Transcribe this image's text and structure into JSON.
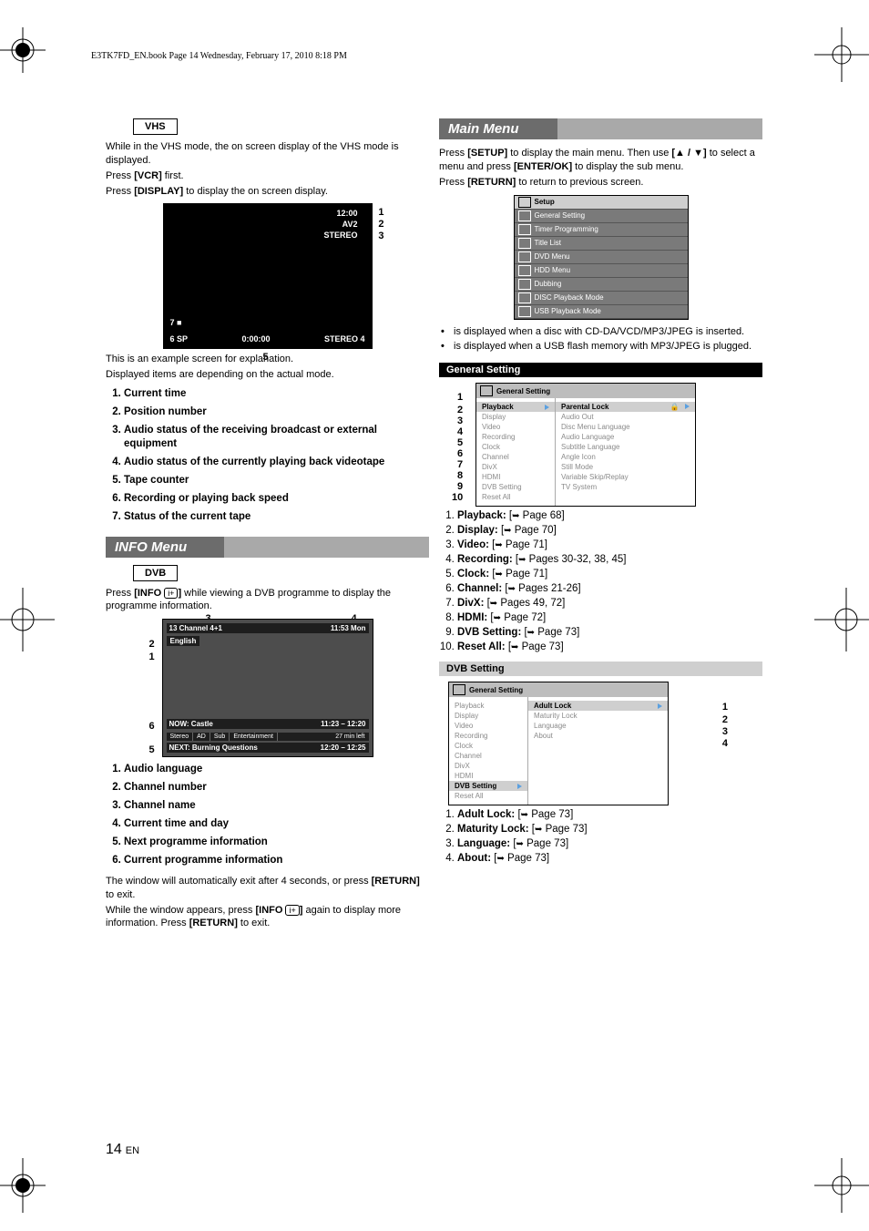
{
  "header_line": "E3TK7FD_EN.book  Page 14  Wednesday, February 17, 2010  8:18 PM",
  "page_num": "14",
  "page_lang": "EN",
  "vhs": {
    "badge": "VHS",
    "p1a": "While in the VHS mode, the on screen display of the VHS mode is displayed.",
    "p2a": "Press ",
    "p2b": "[VCR]",
    "p2c": " first.",
    "p3a": "Press ",
    "p3b": "[DISPLAY]",
    "p3c": " to display the on screen display.",
    "screen": {
      "time": "12:00",
      "av": "AV2",
      "stereo_top": "STEREO",
      "sp": "SP",
      "counter": "0:00:00",
      "stereo_bot": "STEREO",
      "stop": "■"
    },
    "caption1": "This is an example screen for explanation.",
    "caption2": "Displayed items are depending on the actual mode.",
    "defs": [
      "Current time",
      "Position number",
      "Audio status of the receiving broadcast or external equipment",
      "Audio status of the currently playing back videotape",
      "Tape counter",
      "Recording or playing back speed",
      "Status of the current tape"
    ]
  },
  "info": {
    "title": "INFO Menu",
    "badge": "DVB",
    "p1a": "Press ",
    "p1b": "[INFO ",
    "p1c": "]",
    "p1d": " while viewing a DVB programme to display the programme information.",
    "screen": {
      "ch_num": "13",
      "ch_name": "Channel 4+1",
      "time_day": "11:53 Mon",
      "lang": "English",
      "now": "NOW: Castle",
      "now_t": "11:23 – 12:20",
      "tags": [
        "Stereo",
        "AD",
        "Sub",
        "Entertainment"
      ],
      "remain": "27 min left",
      "next": "NEXT: Burning Questions",
      "next_t": "12:20 – 12:25"
    },
    "defs": [
      "Audio language",
      "Channel number",
      "Channel name",
      "Current time and day",
      "Next programme information",
      "Current programme information"
    ],
    "note1a": "The window will automatically exit after 4 seconds, or press ",
    "note1b": "[RETURN]",
    "note1c": " to exit.",
    "note2a": "While the window appears, press ",
    "note2b": "[INFO ",
    "note2c": "]",
    "note2d": " again to display more information. Press ",
    "note2e": "[RETURN]",
    "note2f": " to exit."
  },
  "main": {
    "title": "Main Menu",
    "p1a": "Press ",
    "p1b": "[SETUP]",
    "p1c": " to display the main menu. Then use ",
    "p1d": "[▲ / ▼]",
    "p1e": " to select a menu and press ",
    "p1f": "[ENTER/OK]",
    "p1g": " to display the sub menu.",
    "p2a": "Press ",
    "p2b": "[RETURN]",
    "p2c": " to return to previous screen.",
    "setup_items": [
      "Setup",
      "General Setting",
      "Timer Programming",
      "Title List",
      "DVD Menu",
      "HDD Menu",
      "Dubbing",
      "DISC Playback Mode",
      "USB Playback Mode"
    ],
    "bullets": [
      "is displayed when a disc with CD-DA/VCD/MP3/JPEG is inserted.",
      "is displayed when a USB flash memory with MP3/JPEG is plugged."
    ]
  },
  "general": {
    "bar": "General Setting",
    "left": [
      "Playback",
      "Display",
      "Video",
      "Recording",
      "Clock",
      "Channel",
      "DivX",
      "HDMI",
      "DVB Setting",
      "Reset All"
    ],
    "right": [
      "Parental Lock",
      "Audio Out",
      "Disc Menu Language",
      "Audio Language",
      "Subtitle Language",
      "Angle Icon",
      "Still Mode",
      "Variable Skip/Replay",
      "TV System"
    ],
    "refs": [
      {
        "b": "Playback:",
        "t": " Page 68]"
      },
      {
        "b": "Display:",
        "t": " Page 70]"
      },
      {
        "b": "Video:",
        "t": " Page 71]"
      },
      {
        "b": "Recording:",
        "t": " Pages 30-32, 38, 45]"
      },
      {
        "b": "Clock:",
        "t": " Page 71]"
      },
      {
        "b": "Channel:",
        "t": " Pages 21-26]"
      },
      {
        "b": "DivX:",
        "t": " Pages 49, 72]"
      },
      {
        "b": "HDMI:",
        "t": " Page 72]"
      },
      {
        "b": "DVB Setting:",
        "t": " Page 73]"
      },
      {
        "b": "Reset All:",
        "t": " Page 73]"
      }
    ]
  },
  "dvb": {
    "bar": "DVB Setting",
    "left": [
      "Playback",
      "Display",
      "Video",
      "Recording",
      "Clock",
      "Channel",
      "DivX",
      "HDMI",
      "DVB Setting",
      "Reset All"
    ],
    "right": [
      "Adult Lock",
      "Maturity Lock",
      "Language",
      "About"
    ],
    "refs": [
      {
        "b": "Adult Lock:",
        "t": " Page 73]"
      },
      {
        "b": "Maturity Lock:",
        "t": " Page 73]"
      },
      {
        "b": "Language:",
        "t": " Page 73]"
      },
      {
        "b": "About:",
        "t": " Page 73]"
      }
    ]
  }
}
